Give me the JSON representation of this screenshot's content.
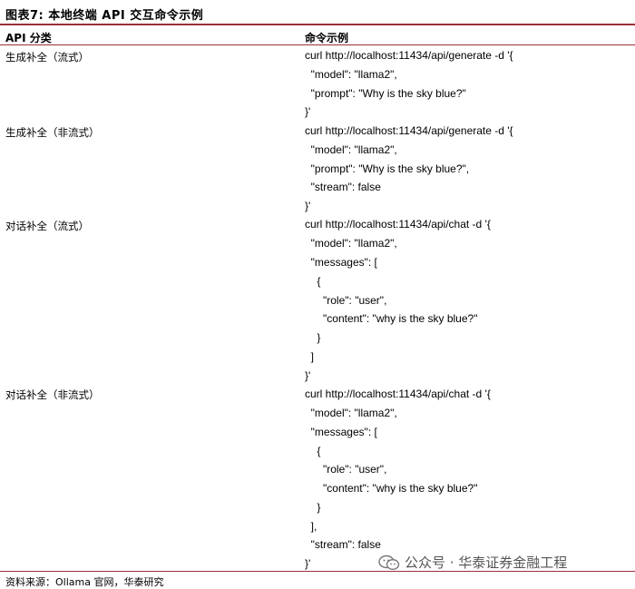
{
  "title": "图表7:  本地终端 API 交互命令示例",
  "header": {
    "col_category": "API 分类",
    "col_command": "命令示例"
  },
  "rows": [
    {
      "category": "生成补全（流式）",
      "lines": [
        "curl http://localhost:11434/api/generate -d '{",
        "  \"model\": \"llama2\",",
        "  \"prompt\": \"Why is the sky blue?\"",
        "}'"
      ]
    },
    {
      "category": "生成补全（非流式）",
      "lines": [
        "curl http://localhost:11434/api/generate -d '{",
        "  \"model\": \"llama2\",",
        "  \"prompt\": \"Why is the sky blue?\",",
        "  \"stream\": false",
        "}'"
      ]
    },
    {
      "category": "对话补全（流式）",
      "lines": [
        "curl http://localhost:11434/api/chat -d '{",
        "  \"model\": \"llama2\",",
        "  \"messages\": [",
        "    {",
        "      \"role\": \"user\",",
        "      \"content\": \"why is the sky blue?\"",
        "    }",
        "  ]",
        "}'"
      ]
    },
    {
      "category": "对话补全（非流式）",
      "lines": [
        "curl http://localhost:11434/api/chat -d '{",
        "  \"model\": \"llama2\",",
        "  \"messages\": [",
        "    {",
        "      \"role\": \"user\",",
        "      \"content\": \"why is the sky blue?\"",
        "    }",
        "  ],",
        "  \"stream\": false",
        "}'"
      ]
    }
  ],
  "source": "资料来源：Ollama 官网，华泰研究",
  "watermark": "公众号 · 华泰证券金融工程",
  "colors": {
    "accent_rule": "#9b2f3a",
    "watermark": "#555555"
  },
  "icons": {
    "watermark_icon": "wechat-icon"
  }
}
